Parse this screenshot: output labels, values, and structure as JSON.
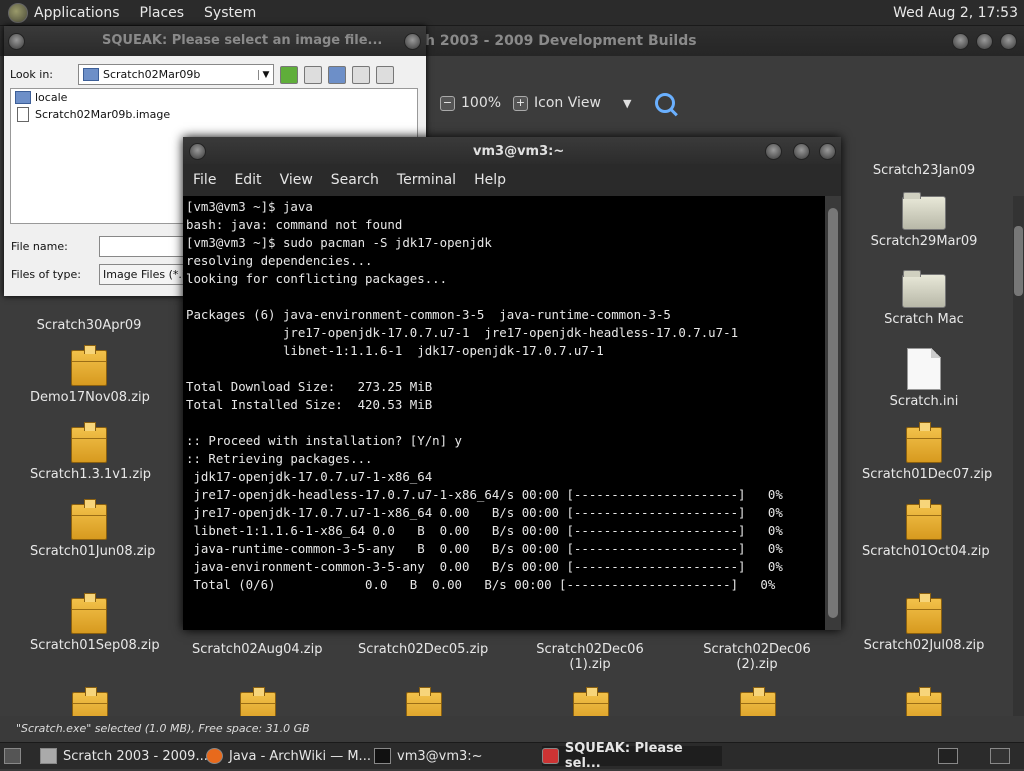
{
  "top_panel": {
    "menus": [
      "Applications",
      "Places",
      "System"
    ],
    "clock": "Wed Aug  2, 17:53"
  },
  "file_manager": {
    "title": "h 2003 - 2009 Development Builds",
    "zoom": "100%",
    "view_mode": "Icon View",
    "status": "\"Scratch.exe\" selected (1.0 MB), Free space: 31.0 GB",
    "icons": [
      {
        "label": "Scratch23Jan09",
        "type": "none"
      },
      {
        "label": "Scratch29Mar09",
        "type": "folder"
      },
      {
        "label": "Scratch Mac",
        "type": "folder"
      },
      {
        "label": "Scratch.ini",
        "type": "file"
      },
      {
        "label": "Scratch30Apr09",
        "type": "none"
      },
      {
        "label": "Demo17Nov08.zip",
        "type": "box"
      },
      {
        "label": "Scratch1.3.1v1.zip",
        "type": "box"
      },
      {
        "label": "Scratch01Jun08.zip",
        "type": "box"
      },
      {
        "label": "Scratch01Sep08.zip",
        "type": "box"
      },
      {
        "label": "Scratch02Aug04.zip",
        "type": "none"
      },
      {
        "label": "Scratch02Dec05.zip",
        "type": "none"
      },
      {
        "label": "Scratch02Dec06 (1).zip",
        "type": "none"
      },
      {
        "label": "Scratch02Dec06 (2).zip",
        "type": "none"
      },
      {
        "label": "Scratch02Jul08.zip",
        "type": "box"
      },
      {
        "label": "Scratch01Dec07.zip",
        "type": "box"
      },
      {
        "label": "Scratch01Oct04.zip",
        "type": "box"
      }
    ]
  },
  "squeak_dialog": {
    "title": "SQUEAK: Please select an image file...",
    "look_in_label": "Look in:",
    "look_in_value": "Scratch02Mar09b",
    "items": [
      "locale",
      "Scratch02Mar09b.image"
    ],
    "file_name_label": "File name:",
    "file_name_value": "",
    "file_type_label": "Files of type:",
    "file_type_value": "Image Files (*.ir"
  },
  "terminal": {
    "title": "vm3@vm3:~",
    "menu": [
      "File",
      "Edit",
      "View",
      "Search",
      "Terminal",
      "Help"
    ],
    "lines": [
      "[vm3@vm3 ~]$ java",
      "bash: java: command not found",
      "[vm3@vm3 ~]$ sudo pacman -S jdk17-openjdk",
      "resolving dependencies...",
      "looking for conflicting packages...",
      "",
      "Packages (6) java-environment-common-3-5  java-runtime-common-3-5",
      "             jre17-openjdk-17.0.7.u7-1  jre17-openjdk-headless-17.0.7.u7-1",
      "             libnet-1:1.1.6-1  jdk17-openjdk-17.0.7.u7-1",
      "",
      "Total Download Size:   273.25 MiB",
      "Total Installed Size:  420.53 MiB",
      "",
      ":: Proceed with installation? [Y/n] y",
      ":: Retrieving packages...",
      " jdk17-openjdk-17.0.7.u7-1-x86_64",
      " jre17-openjdk-headless-17.0.7.u7-1-x86_64/s 00:00 [----------------------]   0%",
      " jre17-openjdk-17.0.7.u7-1-x86_64 0.00   B/s 00:00 [----------------------]   0%",
      " libnet-1:1.1.6-1-x86_64 0.0   B  0.00   B/s 00:00 [----------------------]   0%",
      " java-runtime-common-3-5-any   B  0.00   B/s 00:00 [----------------------]   0%",
      " java-environment-common-3-5-any  0.00   B/s 00:00 [----------------------]   0%",
      " Total (0/6)            0.0   B  0.00   B/s 00:00 [----------------------]   0%"
    ]
  },
  "taskbar": {
    "tasks": [
      "Scratch 2003 - 2009...",
      "Java - ArchWiki — M...",
      "vm3@vm3:~",
      "SQUEAK: Please sel..."
    ]
  }
}
